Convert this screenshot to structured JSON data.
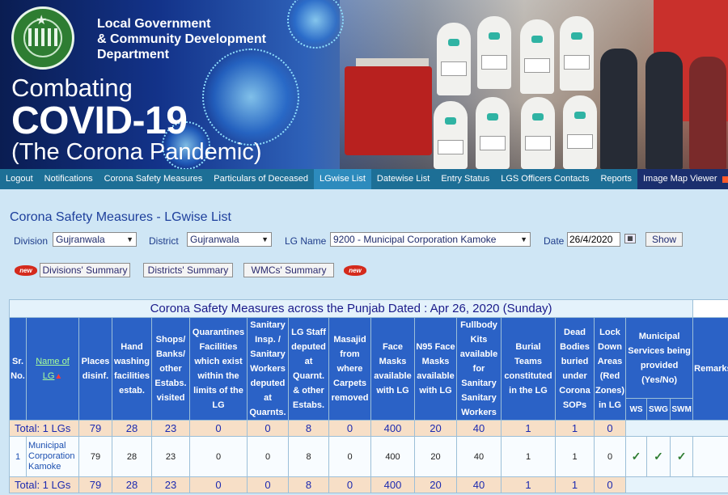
{
  "header": {
    "dept_line1": "Local Government",
    "dept_line2": "& Community Development",
    "dept_line3": "Department",
    "title_line1": "Combating",
    "title_line2": "COVID-19",
    "title_line3": "(The Corona Pandemic)"
  },
  "nav": {
    "items": [
      "Logout",
      "Notifications",
      "Corona Safety Measures",
      "Particulars of Deceased",
      "LGwise List",
      "Datewise List",
      "Entry Status",
      "LGS Officers Contacts",
      "Reports",
      "Image Map Viewer"
    ],
    "active": "LGwise List"
  },
  "page_title": "Corona Safety Measures - LGwise List",
  "filters": {
    "division_label": "Division",
    "division_value": "Gujranwala",
    "district_label": "District",
    "district_value": "Gujranwala",
    "lg_label": "LG Name",
    "lg_value": "9200 - Municipal Corporation Kamoke",
    "date_label": "Date",
    "date_value": "26/4/2020",
    "show_label": "Show"
  },
  "summary": {
    "new_badge": "new",
    "divisions": "Divisions' Summary",
    "districts": "Districts' Summary",
    "wmcs": "WMCs' Summary"
  },
  "table": {
    "caption": "Corona Safety Measures across the Punjab Dated : Apr 26, 2020 (Sunday)",
    "headers": {
      "sr": "Sr. No.",
      "name": "Name of LG",
      "places": "Places disinf.",
      "hand": "Hand washing facilities estab.",
      "shops": "Shops/ Banks/ other Estabs. visited",
      "quarantines": "Quarantines Facilities which exist within the limits of the LG",
      "sanitary": "Sanitary Insp. / Sanitary Workers deputed at Quarnts.",
      "lgstaff": "LG Staff deputed at Quarnt. & other Estabs.",
      "masajid": "Masajid from where Carpets removed",
      "facemasks": "Face Masks available with LG",
      "n95": "N95 Face Masks available with LG",
      "fullbody": "Fullbody Kits available for Sanitary Sanitary Workers",
      "burial": "Burial Teams constituted in the LG",
      "dead": "Dead Bodies buried under Corona SOPs",
      "lockdown": "Lock Down Areas (Red Zones) in LG",
      "municipal": "Municipal Services being provided (Yes/No)",
      "remarks": "Remarks",
      "ws": "WS",
      "swg": "SWG",
      "swm": "SWM"
    },
    "total_top": {
      "label": "Total: 1 LGs",
      "values": [
        "79",
        "28",
        "23",
        "0",
        "0",
        "8",
        "0",
        "400",
        "20",
        "40",
        "1",
        "1",
        "0"
      ]
    },
    "row": {
      "sr": "1",
      "name": "Municipal Corporation Kamoke",
      "values": [
        "79",
        "28",
        "23",
        "0",
        "0",
        "8",
        "0",
        "400",
        "20",
        "40",
        "1",
        "1",
        "0"
      ],
      "ws": "✓",
      "swg": "✓",
      "swm": "✓"
    },
    "total_bottom": {
      "label": "Total: 1 LGs",
      "values": [
        "79",
        "28",
        "23",
        "0",
        "0",
        "8",
        "0",
        "400",
        "20",
        "40",
        "1",
        "1",
        "0"
      ]
    }
  }
}
